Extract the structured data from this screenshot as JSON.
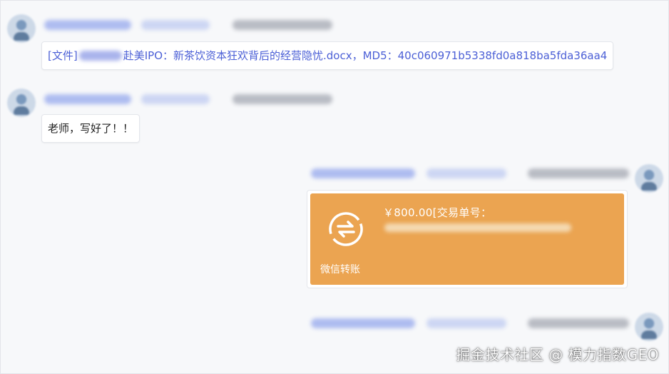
{
  "messages": [
    {
      "id": "msg1",
      "side": "left",
      "type": "file",
      "text_prefix": "[文件]",
      "text_suffix": "赴美IPO：新茶饮资本狂欢背后的经营隐忧.docx，MD5：40c060971b5338fd0a818ba5fda36aa4"
    },
    {
      "id": "msg2",
      "side": "left",
      "type": "text",
      "text": "老师，写好了！！"
    },
    {
      "id": "msg3",
      "side": "right",
      "type": "transfer",
      "amount_text": "￥800.00[交易单号：",
      "label": "微信转账"
    },
    {
      "id": "msg4",
      "side": "right",
      "type": "pending"
    }
  ],
  "watermark": "掘金技术社区 @ 模力指数GEO",
  "colors": {
    "transfer_card": "#eba451",
    "file_text": "#4b5fd6",
    "background": "#f7f8fa"
  },
  "icons": {
    "transfer": "transfer-arrows-icon"
  }
}
